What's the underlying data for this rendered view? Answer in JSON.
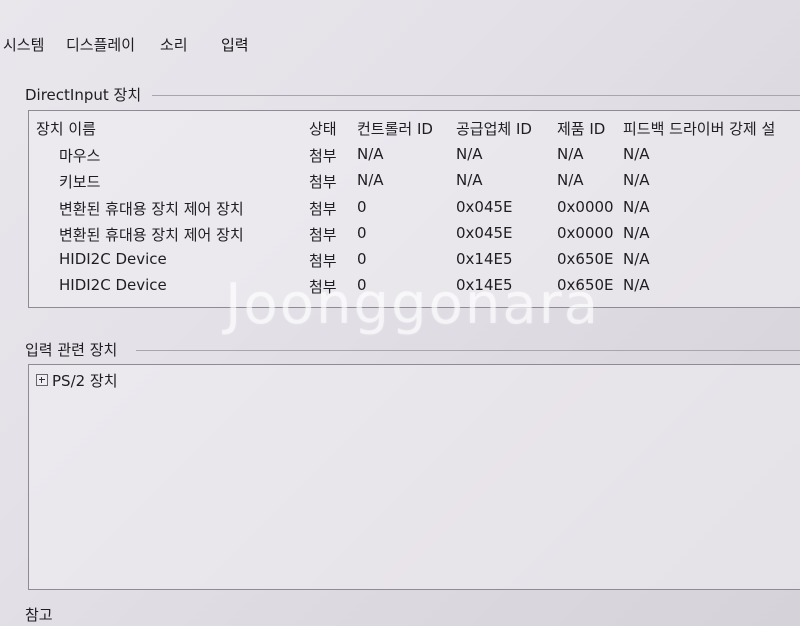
{
  "tabs": [
    "시스템",
    "디스플레이",
    "소리",
    "입력"
  ],
  "directinput": {
    "title": "DirectInput 장치",
    "columns": [
      "장치 이름",
      "상태",
      "컨트롤러 ID",
      "공급업체 ID",
      "제품 ID",
      "피드백 드라이버 강제 설"
    ],
    "rows": [
      [
        "마우스",
        "첨부",
        "N/A",
        "N/A",
        "N/A",
        "N/A"
      ],
      [
        "키보드",
        "첨부",
        "N/A",
        "N/A",
        "N/A",
        "N/A"
      ],
      [
        "변환된 휴대용 장치 제어 장치",
        "첨부",
        "0",
        "0x045E",
        "0x0000",
        "N/A"
      ],
      [
        "변환된 휴대용 장치 제어 장치",
        "첨부",
        "0",
        "0x045E",
        "0x0000",
        "N/A"
      ],
      [
        "HIDI2C Device",
        "첨부",
        "0",
        "0x14E5",
        "0x650E",
        "N/A"
      ],
      [
        "HIDI2C Device",
        "첨부",
        "0",
        "0x14E5",
        "0x650E",
        "N/A"
      ]
    ]
  },
  "input_related": {
    "title": "입력 관련 장치",
    "items": [
      "PS/2 장치"
    ]
  },
  "notes": {
    "title": "참고"
  },
  "watermark": "Joonggonara"
}
